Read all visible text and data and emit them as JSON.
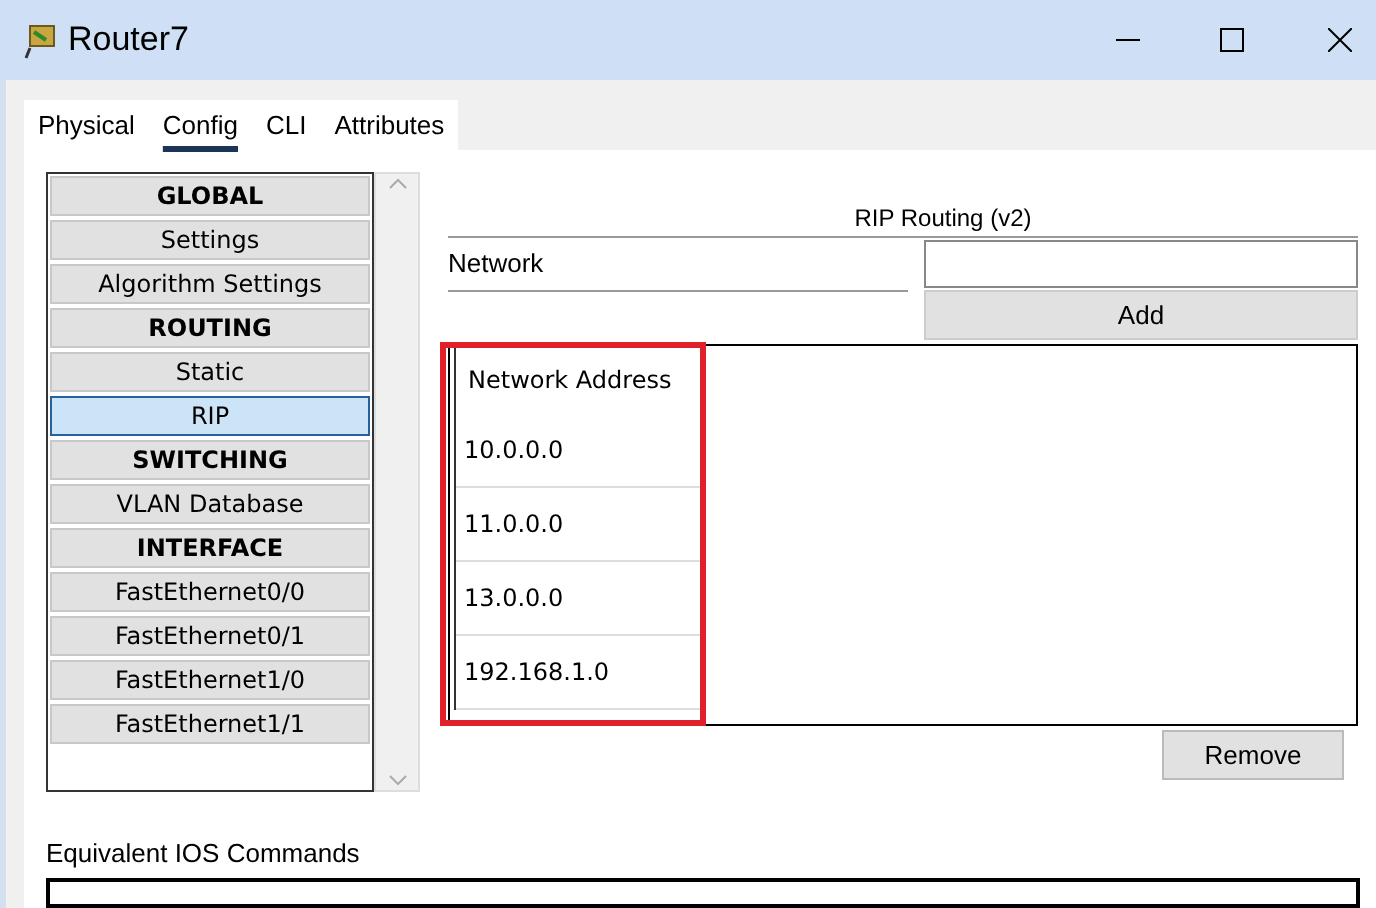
{
  "window": {
    "title": "Router7"
  },
  "tabs": [
    {
      "label": "Physical",
      "selected": false
    },
    {
      "label": "Config",
      "selected": true
    },
    {
      "label": "CLI",
      "selected": false
    },
    {
      "label": "Attributes",
      "selected": false
    }
  ],
  "sidebar": {
    "items": [
      {
        "label": "GLOBAL",
        "kind": "header",
        "selected": false
      },
      {
        "label": "Settings",
        "kind": "item",
        "selected": false
      },
      {
        "label": "Algorithm Settings",
        "kind": "item",
        "selected": false
      },
      {
        "label": "ROUTING",
        "kind": "header",
        "selected": false
      },
      {
        "label": "Static",
        "kind": "item",
        "selected": false
      },
      {
        "label": "RIP",
        "kind": "item",
        "selected": true
      },
      {
        "label": "SWITCHING",
        "kind": "header",
        "selected": false
      },
      {
        "label": "VLAN Database",
        "kind": "item",
        "selected": false
      },
      {
        "label": "INTERFACE",
        "kind": "header",
        "selected": false
      },
      {
        "label": "FastEthernet0/0",
        "kind": "item",
        "selected": false
      },
      {
        "label": "FastEthernet0/1",
        "kind": "item",
        "selected": false
      },
      {
        "label": "FastEthernet1/0",
        "kind": "item",
        "selected": false
      },
      {
        "label": "FastEthernet1/1",
        "kind": "item",
        "selected": false
      }
    ]
  },
  "rip": {
    "heading": "RIP Routing (v2)",
    "network_label": "Network",
    "add_button": "Add",
    "table": {
      "columns": [
        "Network Address"
      ],
      "rows": [
        [
          "10.0.0.0"
        ],
        [
          "11.0.0.0"
        ],
        [
          "13.0.0.0"
        ],
        [
          "192.168.1.0"
        ]
      ]
    },
    "remove_button": "Remove"
  },
  "ios": {
    "label": "Equivalent IOS Commands"
  }
}
